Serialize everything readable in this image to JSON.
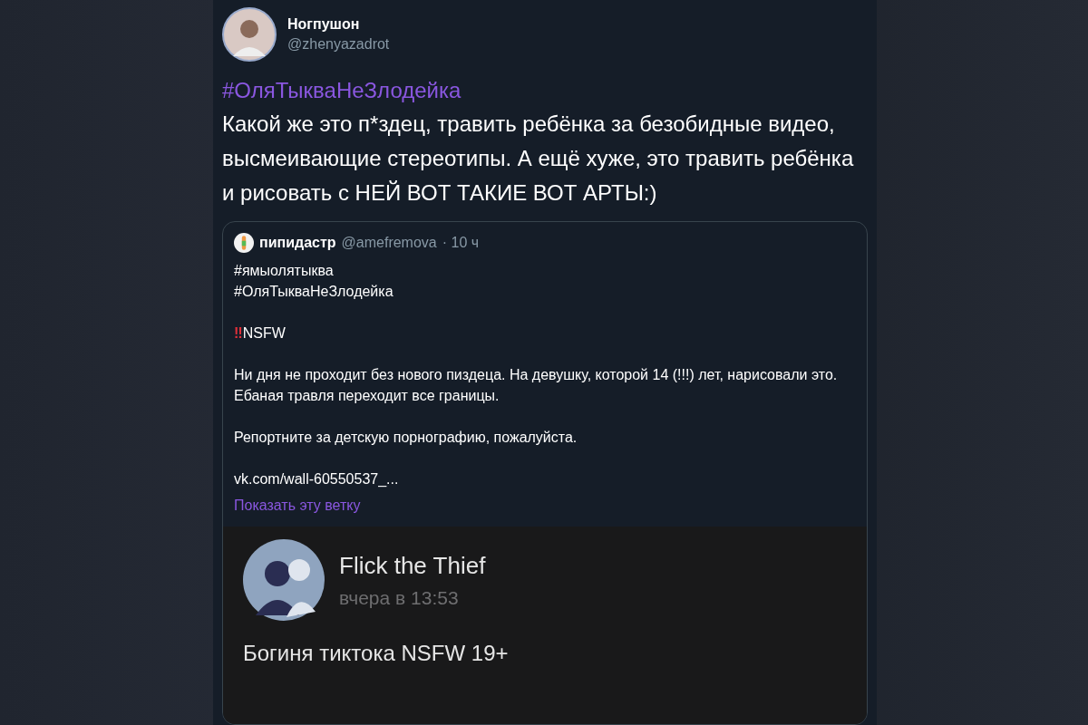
{
  "tweet": {
    "author": "Ногпушон",
    "handle": "@zhenyazadrot",
    "hashtag": "#ОляТыкваНеЗлодейка",
    "text": "Какой же это п*здец, травить ребёнка за безобидные видео, высмеивающие стереотипы. А ещё хуже, это травить ребёнка и рисовать с НЕЙ ВОТ ТАКИЕ ВОТ АРТЫ:)"
  },
  "quote": {
    "author": "пипидастр",
    "handle": "@amefremova",
    "time": "· 10 ч",
    "hashtags": [
      "#ямыолятыква",
      "#ОляТыкваНеЗлодейка"
    ],
    "warning": {
      "mark": "‼",
      "text": "NSFW"
    },
    "paragraphs": [
      "Ни дня не проходит без нового пиздеца. На девушку, которой 14 (!!!) лет, нарисовали это. Ебаная травля переходит все границы.",
      "Репортните за детскую порнографию, пожалуйста."
    ],
    "link": "vk.com/wall-60550537_...",
    "thread_link": "Показать эту ветку"
  },
  "screenshot": {
    "author": "Flick the Thief",
    "time": "вчера в 13:53",
    "title": "Богиня тиктока NSFW 19+"
  }
}
